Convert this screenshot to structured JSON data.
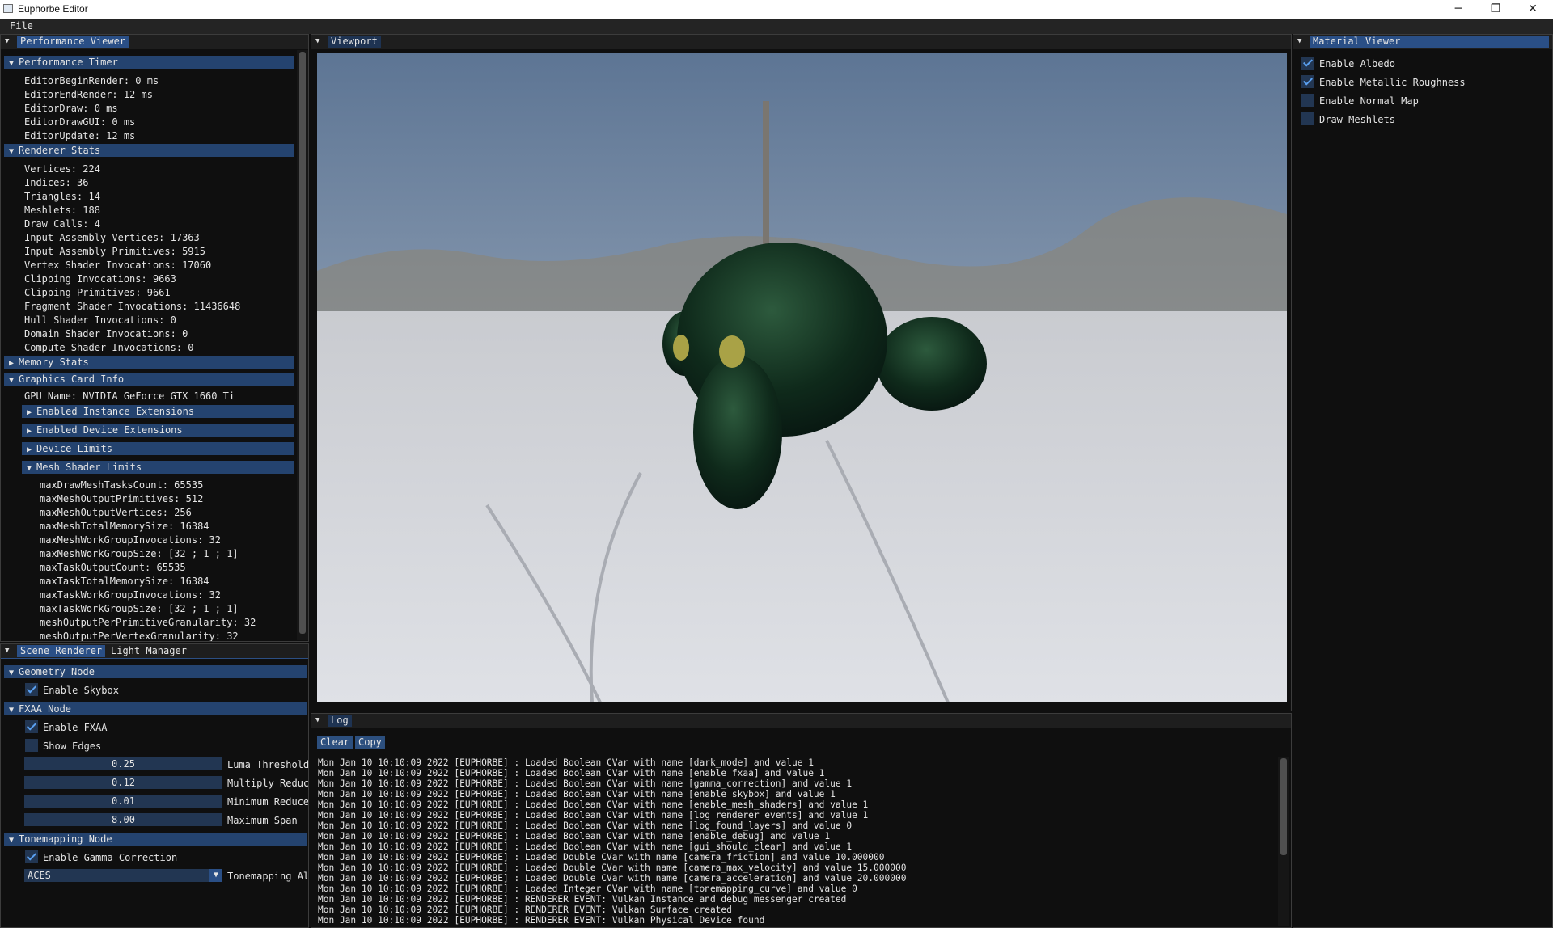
{
  "window": {
    "title": "Euphorbe Editor",
    "minimize": "─",
    "maximize": "❐",
    "close": "✕"
  },
  "menu": {
    "file": "File"
  },
  "perf_panel": {
    "tab": "Performance Viewer",
    "timer_title": "Performance Timer",
    "timer_rows": [
      "EditorBeginRender: 0 ms",
      "EditorEndRender: 12 ms",
      "EditorDraw: 0 ms",
      "EditorDrawGUI: 0 ms",
      "EditorUpdate: 12 ms"
    ],
    "stats_title": "Renderer Stats",
    "stats_rows": [
      "Vertices: 224",
      "Indices: 36",
      "Triangles: 14",
      "Meshlets: 188",
      "Draw Calls: 4",
      "Input Assembly Vertices: 17363",
      "Input Assembly Primitives: 5915",
      "Vertex Shader Invocations: 17060",
      "Clipping Invocations: 9663",
      "Clipping Primitives: 9661",
      "Fragment Shader Invocations: 11436648",
      "Hull Shader Invocations: 0",
      "Domain Shader Invocations: 0",
      "Compute Shader Invocations: 0"
    ],
    "memory_title": "Memory Stats",
    "gpu_title": "Graphics Card Info",
    "gpu_name": "GPU Name: NVIDIA GeForce GTX 1660 Ti",
    "sub_instance": "Enabled Instance Extensions",
    "sub_device_ext": "Enabled Device Extensions",
    "sub_limits": "Device Limits",
    "sub_mesh": "Mesh Shader Limits",
    "mesh_rows": [
      "maxDrawMeshTasksCount: 65535",
      "maxMeshOutputPrimitives: 512",
      "maxMeshOutputVertices: 256",
      "maxMeshTotalMemorySize: 16384",
      "maxMeshWorkGroupInvocations: 32",
      "maxMeshWorkGroupSize: [32 ; 1 ; 1]",
      "maxTaskOutputCount: 65535",
      "maxTaskTotalMemorySize: 16384",
      "maxTaskWorkGroupInvocations: 32",
      "maxTaskWorkGroupSize: [32 ; 1 ; 1]",
      "meshOutputPerPrimitiveGranularity: 32",
      "meshOutputPerVertexGranularity: 32"
    ]
  },
  "scene_panel": {
    "tab_scene": "Scene Renderer",
    "tab_light": "Light Manager",
    "geometry_title": "Geometry Node",
    "enable_skybox": "Enable Skybox",
    "fxaa_title": "FXAA Node",
    "enable_fxaa": "Enable FXAA",
    "show_edges": "Show Edges",
    "sliders": [
      {
        "value": "0.25",
        "label": "Luma Threshold"
      },
      {
        "value": "0.12",
        "label": "Multiply Reduc"
      },
      {
        "value": "0.01",
        "label": "Minimum Reduce"
      },
      {
        "value": "8.00",
        "label": "Maximum Span"
      }
    ],
    "tonemap_title": "Tonemapping Node",
    "enable_gamma": "Enable Gamma Correction",
    "tonemap_value": "ACES",
    "tonemap_label": "Tonemapping Al"
  },
  "viewport": {
    "tab": "Viewport"
  },
  "material_panel": {
    "tab": "Material Viewer",
    "items": [
      {
        "label": "Enable Albedo",
        "checked": true
      },
      {
        "label": "Enable Metallic Roughness",
        "checked": true
      },
      {
        "label": "Enable Normal Map",
        "checked": false
      },
      {
        "label": "Draw Meshlets",
        "checked": false
      }
    ]
  },
  "log_panel": {
    "tab": "Log",
    "clear": "Clear",
    "copy": "Copy",
    "lines": [
      "Mon Jan 10 10:10:09 2022 [EUPHORBE] : Loaded Boolean CVar with name [dark_mode] and value 1",
      "Mon Jan 10 10:10:09 2022 [EUPHORBE] : Loaded Boolean CVar with name [enable_fxaa] and value 1",
      "Mon Jan 10 10:10:09 2022 [EUPHORBE] : Loaded Boolean CVar with name [gamma_correction] and value 1",
      "Mon Jan 10 10:10:09 2022 [EUPHORBE] : Loaded Boolean CVar with name [enable_skybox] and value 1",
      "Mon Jan 10 10:10:09 2022 [EUPHORBE] : Loaded Boolean CVar with name [enable_mesh_shaders] and value 1",
      "Mon Jan 10 10:10:09 2022 [EUPHORBE] : Loaded Boolean CVar with name [log_renderer_events] and value 1",
      "Mon Jan 10 10:10:09 2022 [EUPHORBE] : Loaded Boolean CVar with name [log_found_layers] and value 0",
      "Mon Jan 10 10:10:09 2022 [EUPHORBE] : Loaded Boolean CVar with name [enable_debug] and value 1",
      "Mon Jan 10 10:10:09 2022 [EUPHORBE] : Loaded Boolean CVar with name [gui_should_clear] and value 1",
      "Mon Jan 10 10:10:09 2022 [EUPHORBE] : Loaded Double CVar with name [camera_friction] and value 10.000000",
      "Mon Jan 10 10:10:09 2022 [EUPHORBE] : Loaded Double CVar with name [camera_max_velocity] and value 15.000000",
      "Mon Jan 10 10:10:09 2022 [EUPHORBE] : Loaded Double CVar with name [camera_acceleration] and value 20.000000",
      "Mon Jan 10 10:10:09 2022 [EUPHORBE] : Loaded Integer CVar with name [tonemapping_curve] and value 0",
      "Mon Jan 10 10:10:09 2022 [EUPHORBE] : RENDERER EVENT: Vulkan Instance and debug messenger created",
      "Mon Jan 10 10:10:09 2022 [EUPHORBE] : RENDERER EVENT: Vulkan Surface created",
      "Mon Jan 10 10:10:09 2022 [EUPHORBE] : RENDERER EVENT: Vulkan Physical Device found"
    ]
  }
}
